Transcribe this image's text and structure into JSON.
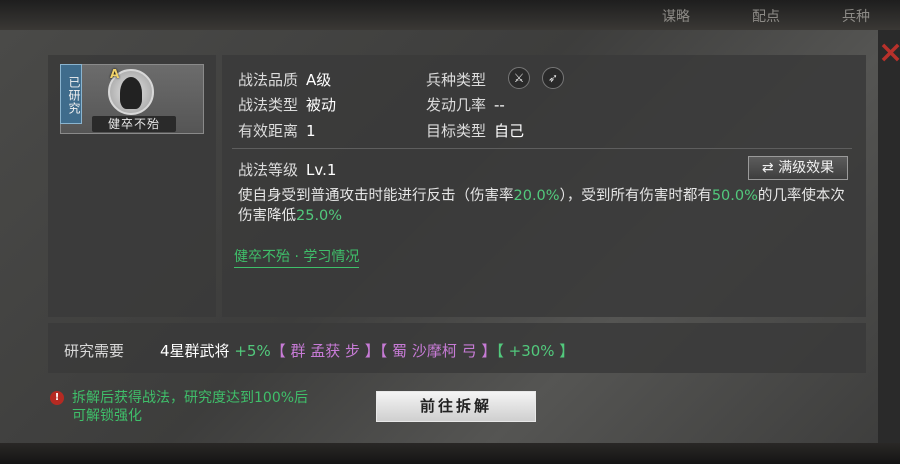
{
  "top_tabs": [
    "谋略",
    "配点",
    "兵种"
  ],
  "close_icon": "×",
  "card": {
    "banner": "已研究",
    "grade": "A",
    "name": "健卒不殆"
  },
  "info": {
    "quality_label": "战法品质",
    "quality_value": "A级",
    "type_label": "战法类型",
    "type_value": "被动",
    "range_label": "有效距离",
    "range_value": "1",
    "troop_label": "兵种类型",
    "troop_icons": [
      "spear-icon",
      "bow-icon"
    ],
    "rate_label": "发动几率",
    "rate_value": "--",
    "target_label": "目标类型",
    "target_value": "自己"
  },
  "level": {
    "label": "战法等级",
    "value": "Lv.1"
  },
  "full_effect_button": {
    "icon": "⇄",
    "label": "满级效果"
  },
  "description": {
    "p1": "使自身受到普通攻击时能进行反击（伤害率",
    "v1": "20.0%",
    "p2": "），受到所有伤害时都有",
    "v2": "50.0%",
    "p3": "的几率使本次伤害降低",
    "v3": "25.0%"
  },
  "learn_link": "健卒不殆 · 学习情况",
  "research": {
    "label": "研究需要",
    "prefix": "4星群武将",
    "bonus1": "+5%",
    "general1": "【 群 孟获 步 】",
    "general2": "【 蜀 沙摩柯 弓 】",
    "bonus2": "【 +30% 】"
  },
  "warning": {
    "line1": "拆解后获得战法，研究度达到100%后",
    "line2": "可解锁强化"
  },
  "go_button": "前往拆解",
  "colors": {
    "accent_green": "#52c97c",
    "purple": "#c77bd6",
    "close_red": "#b8312b"
  }
}
